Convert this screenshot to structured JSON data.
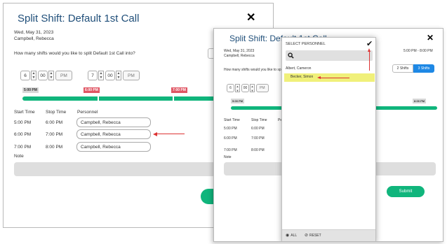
{
  "dialog_back": {
    "title": "Split Shift: Default 1st Call",
    "close_glyph": "✕",
    "date": "Wed, May 31, 2023",
    "person": "Campbell, Rebecca",
    "question": "How many shifts would you like to split Default 1st Call into?",
    "split_time_1": {
      "hour": "6",
      "minute": "00",
      "ampm": "PM"
    },
    "split_time_2": {
      "hour": "7",
      "minute": "00",
      "ampm": "PM"
    },
    "timeline_labels": [
      "5:00 PM",
      "6:00 PM",
      "7:00 PM"
    ],
    "table_headers": {
      "start": "Start Time",
      "stop": "Stop Time",
      "personnel": "Personnel"
    },
    "rows": [
      {
        "start": "5:00 PM",
        "stop": "6:00 PM",
        "personnel": "Campbell, Rebecca"
      },
      {
        "start": "6:00 PM",
        "stop": "7:00 PM",
        "personnel": "Campbell, Rebecca"
      },
      {
        "start": "7:00 PM",
        "stop": "8:00 PM",
        "personnel": "Campbell, Rebecca"
      }
    ],
    "note_label": "Note"
  },
  "dialog_front": {
    "title": "Split Shift: Default 1st Call",
    "close_glyph": "✕",
    "date": "Wed, May 31, 2023",
    "person": "Campbell, Rebecca",
    "time_range": "5:00 PM - 8:00 PM",
    "question": "How many shifts would you like to split Default 1st Call into?",
    "toggle_2": "2 Shifts",
    "toggle_3": "3 Shifts",
    "split_time": {
      "hour": "6",
      "minute": "00",
      "ampm": "PM"
    },
    "timeline_labels": [
      "5:00 PM",
      "8:00 PM"
    ],
    "table_headers": {
      "start": "Start Time",
      "stop": "Stop Time",
      "personnel": "Personnel"
    },
    "rows": [
      {
        "start": "5:00 PM",
        "stop": "6:00 PM"
      },
      {
        "start": "6:00 PM",
        "stop": "7:00 PM"
      },
      {
        "start": "7:00 PM",
        "stop": "8:00 PM"
      }
    ],
    "note_label": "Note",
    "submit_label": "Submit"
  },
  "select_personnel": {
    "header": "SELECT PERSONNEL",
    "confirm_glyph": "✔",
    "search_icon": "magnifier-icon",
    "items": [
      "Albert, Cameron",
      "Becker, Simon"
    ],
    "footer_all": "ALL",
    "footer_reset": "RESET"
  },
  "colors": {
    "title": "#1f4e79",
    "timeline_bar": "#10b57c",
    "selected_marker": "#e05563",
    "highlight": "#f0f07a",
    "toggle_active": "#1e88e5",
    "annotation_arrow": "#dd3333"
  }
}
